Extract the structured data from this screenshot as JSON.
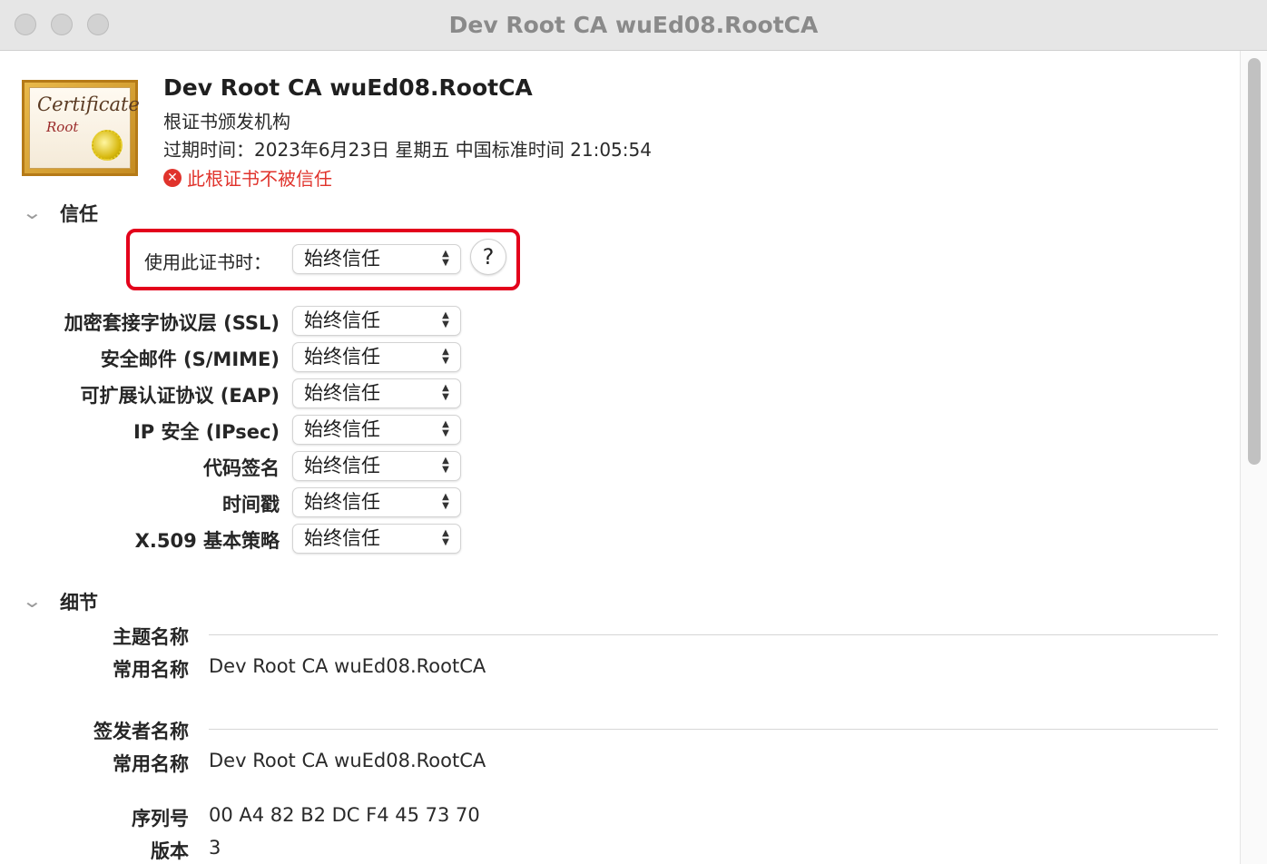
{
  "window": {
    "title": "Dev Root CA wuEd08.RootCA"
  },
  "certificate_icon": {
    "script_text": "Certificate",
    "sub_text": "Root"
  },
  "header": {
    "name": "Dev Root CA wuEd08.RootCA",
    "type": "根证书颁发机构",
    "expiry": "过期时间：2023年6月23日 星期五 中国标准时间 21:05:54",
    "status_icon": "x-circle-icon",
    "status": "此根证书不被信任",
    "status_color": "#e0332c"
  },
  "trust": {
    "title": "信任",
    "when_using_label": "使用此证书时：",
    "when_using_value": "始终信任",
    "help_label": "?",
    "rows": [
      {
        "label": "加密套接字协议层 (SSL)",
        "value": "始终信任"
      },
      {
        "label": "安全邮件 (S/MIME)",
        "value": "始终信任"
      },
      {
        "label": "可扩展认证协议 (EAP)",
        "value": "始终信任"
      },
      {
        "label": "IP 安全 (IPsec)",
        "value": "始终信任"
      },
      {
        "label": "代码签名",
        "value": "始终信任"
      },
      {
        "label": "时间戳",
        "value": "始终信任"
      },
      {
        "label": "X.509 基本策略",
        "value": "始终信任"
      }
    ]
  },
  "details": {
    "title": "细节",
    "subject_heading": "主题名称",
    "subject_cn_label": "常用名称",
    "subject_cn_value": "Dev Root CA wuEd08.RootCA",
    "issuer_heading": "签发者名称",
    "issuer_cn_label": "常用名称",
    "issuer_cn_value": "Dev Root CA wuEd08.RootCA",
    "serial_label": "序列号",
    "serial_value": "00 A4 82 B2 DC F4 45 73 70",
    "version_label": "版本",
    "version_value": "3"
  },
  "colors": {
    "highlight_border": "#e3001b",
    "accent_error": "#e0332c"
  }
}
